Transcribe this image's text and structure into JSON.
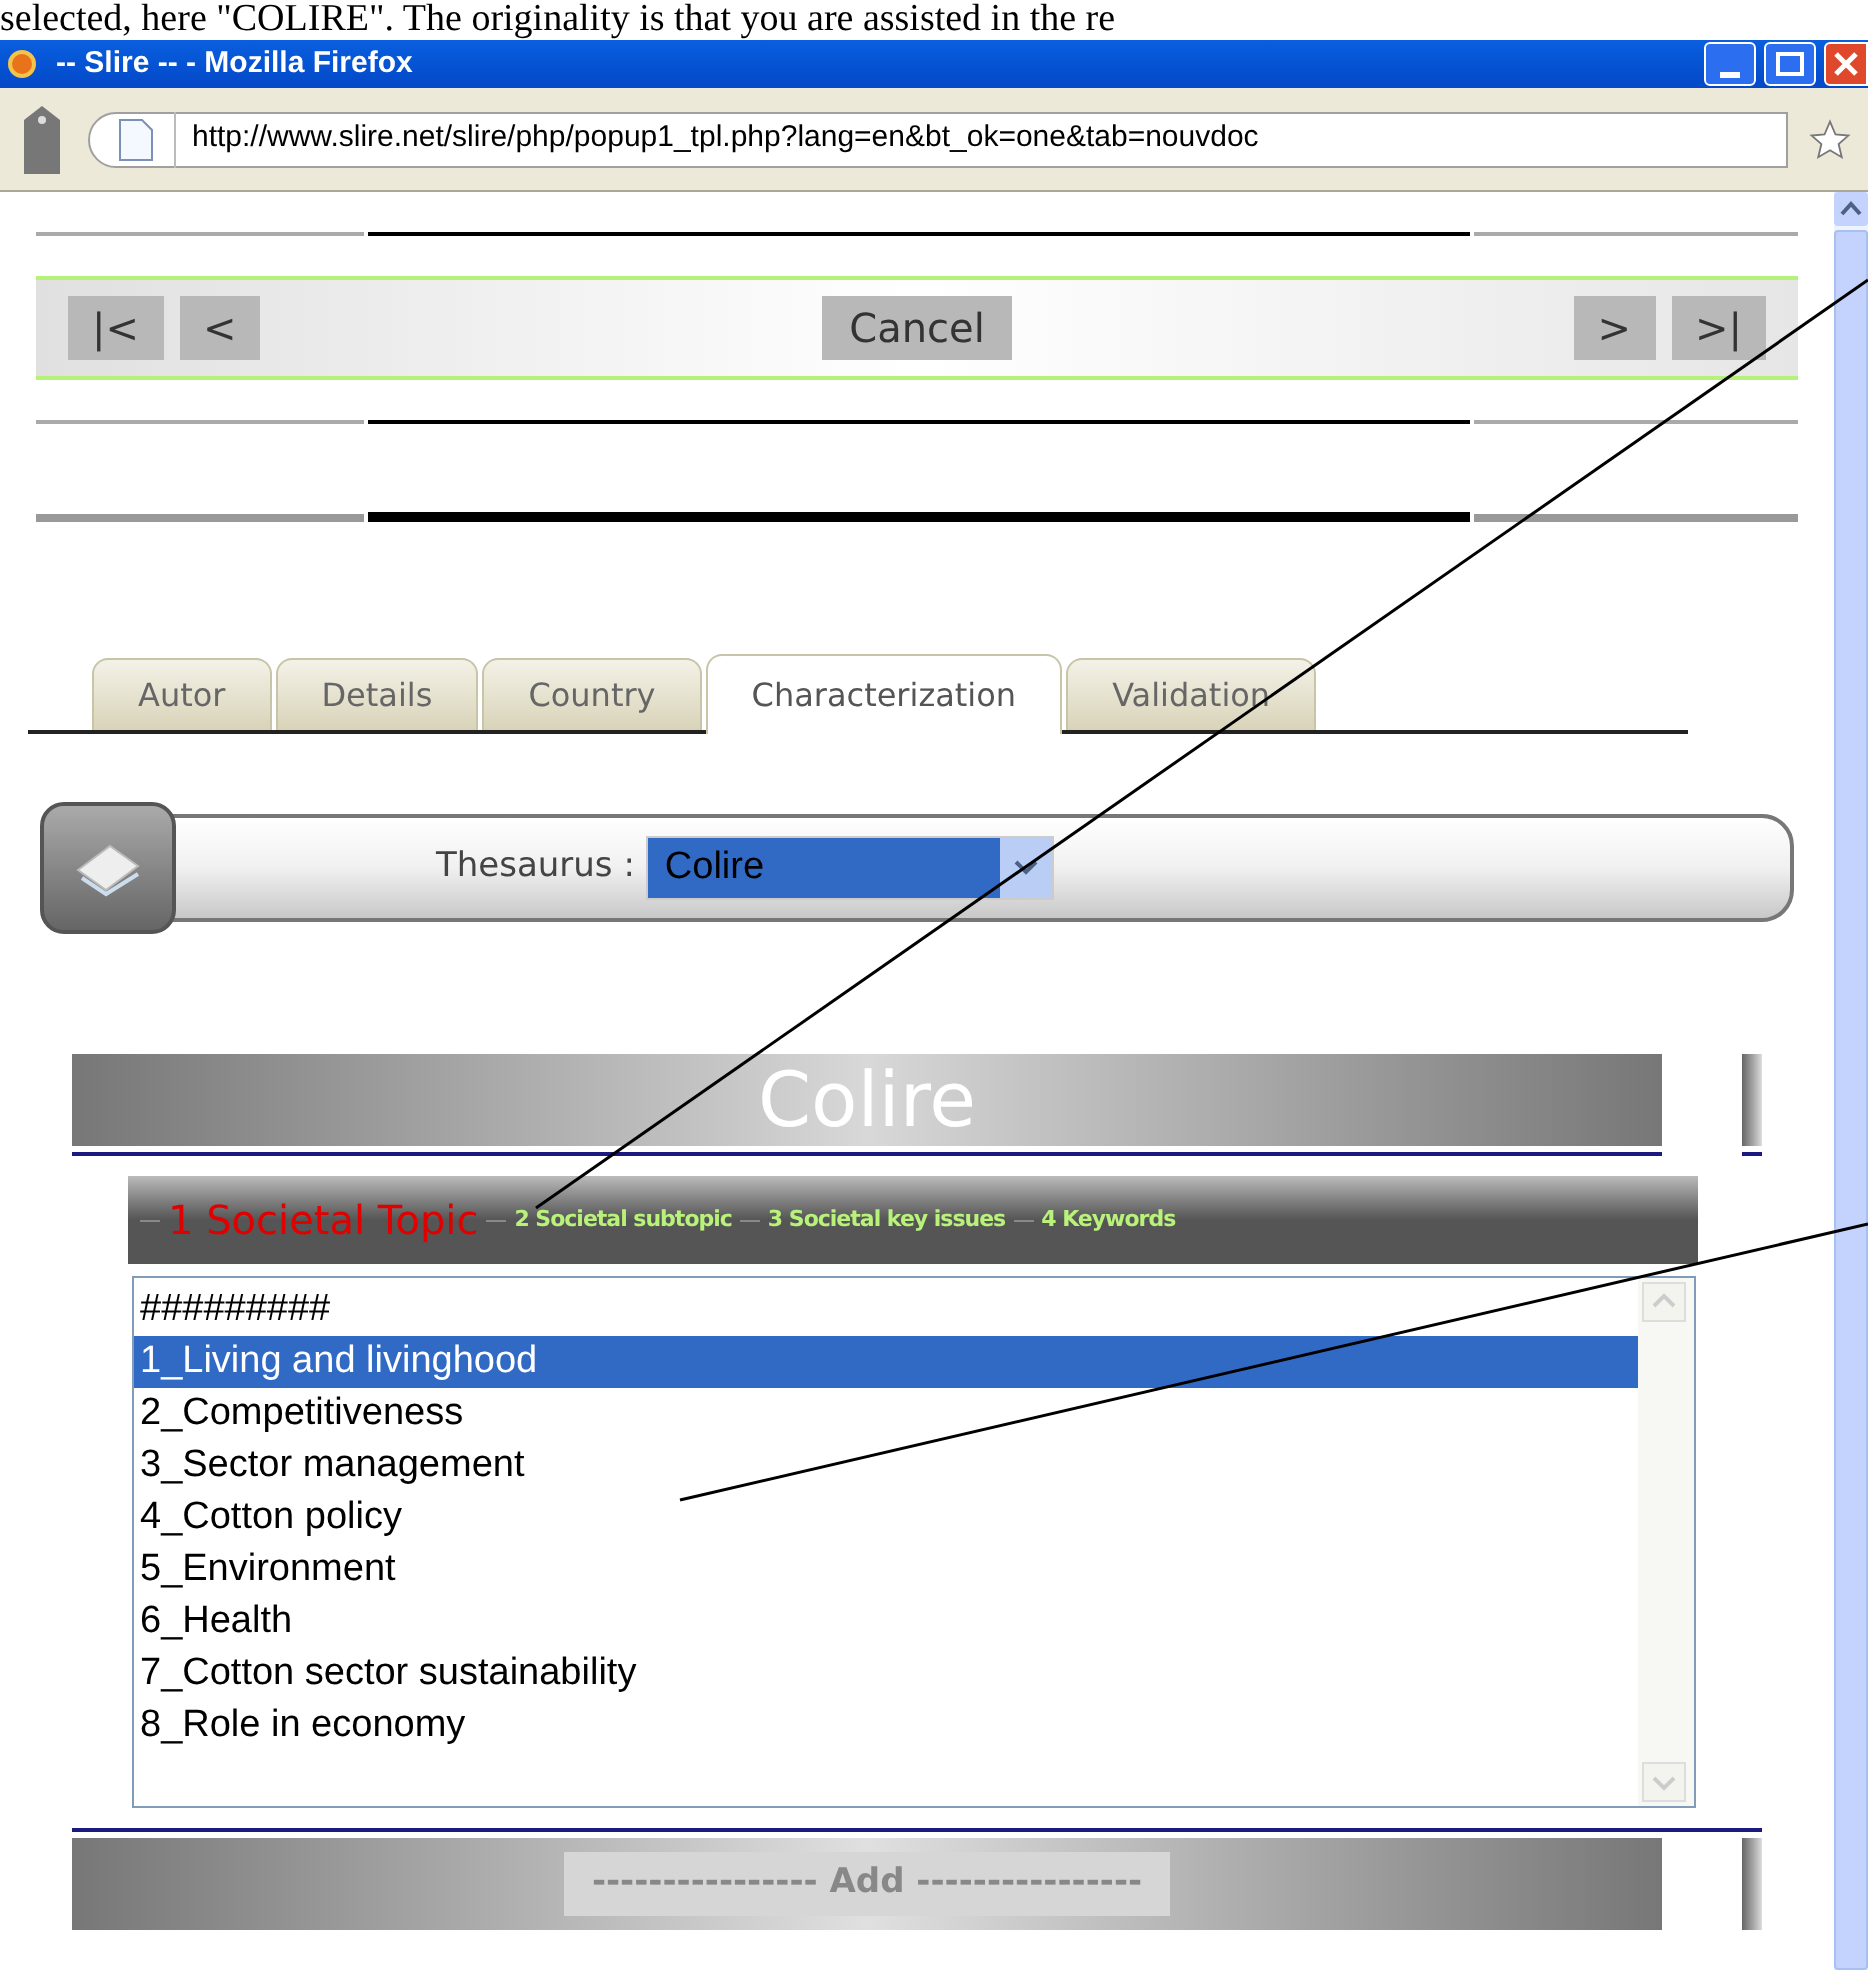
{
  "caption": "selected, here \"COLIRE\". The originality is that you are assisted in the re",
  "window": {
    "title": "-- Slire -- - Mozilla Firefox"
  },
  "address_bar": {
    "url": "http://www.slire.net/slire/php/popup1_tpl.php?lang=en&bt_ok=one&tab=nouvdoc"
  },
  "nav_buttons": [
    {
      "label": "|<",
      "kind": "nav"
    },
    {
      "label": "<",
      "kind": "nav"
    },
    {
      "label": "Cancel",
      "kind": "cancel"
    },
    {
      "label": ">",
      "kind": "nav"
    },
    {
      "label": ">|",
      "kind": "nav"
    }
  ],
  "tabs": [
    {
      "label": "Autor",
      "selected": false
    },
    {
      "label": "Details",
      "selected": false
    },
    {
      "label": "Country",
      "selected": false
    },
    {
      "label": "Characterization",
      "selected": true
    },
    {
      "label": "Validation",
      "selected": false
    }
  ],
  "thesaurus": {
    "label": "Thesaurus :",
    "value": "Colire"
  },
  "section_title": "Colire",
  "steps": [
    {
      "label": "1 Societal Topic",
      "selected": true
    },
    {
      "label": "2 Societal subtopic",
      "selected": false
    },
    {
      "label": "3 Societal key issues",
      "selected": false
    },
    {
      "label": "4 Keywords",
      "selected": false
    }
  ],
  "list": {
    "items": [
      {
        "label": "#########",
        "selected": false
      },
      {
        "label": "1_Living and livinghood",
        "selected": true
      },
      {
        "label": "2_Competitiveness",
        "selected": false
      },
      {
        "label": "3_Sector management",
        "selected": false
      },
      {
        "label": "4_Cotton policy",
        "selected": false
      },
      {
        "label": "5_Environment",
        "selected": false
      },
      {
        "label": "6_Health",
        "selected": false
      },
      {
        "label": "7_Cotton sector sustainability",
        "selected": false
      },
      {
        "label": "8_Role in economy",
        "selected": false
      }
    ]
  },
  "add_button": "---------------- Add ----------------"
}
